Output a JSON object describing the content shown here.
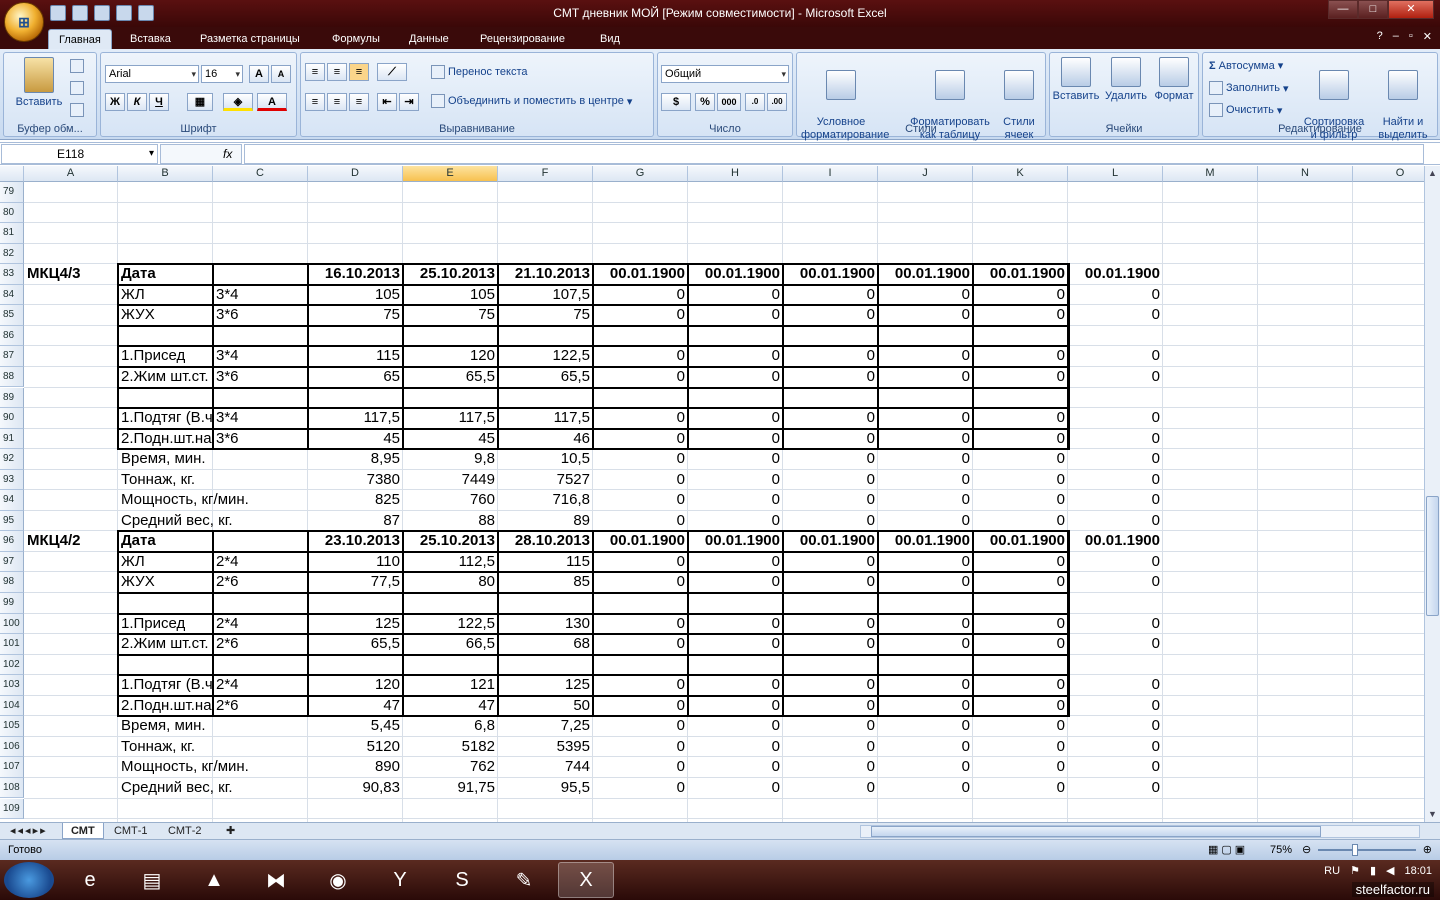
{
  "window": {
    "title": "СМТ дневник МОЙ  [Режим совместимости]  -  Microsoft Excel",
    "minimize": "—",
    "maximize": "□",
    "close": "✕"
  },
  "ribbon_tabs": [
    "Главная",
    "Вставка",
    "Разметка страницы",
    "Формулы",
    "Данные",
    "Рецензирование",
    "Вид"
  ],
  "ribbon": {
    "clipboard": {
      "paste": "Вставить",
      "name": "Буфер обм..."
    },
    "font": {
      "family": "Arial",
      "size": "16",
      "bold": "Ж",
      "italic": "К",
      "underline": "Ч",
      "grow": "A",
      "shrink": "A",
      "name": "Шрифт"
    },
    "alignment": {
      "wrap": "Перенос текста",
      "merge": "Объединить и поместить в центре",
      "name": "Выравнивание"
    },
    "number": {
      "format": "Общий",
      "percent": "%",
      "thousands": "000",
      "name": "Число"
    },
    "styles": {
      "conditional": "Условное\nформатирование",
      "as_table": "Форматировать\nкак таблицу",
      "cell_styles": "Стили\nячеек",
      "name": "Стили"
    },
    "cells": {
      "insert": "Вставить",
      "delete": "Удалить",
      "format": "Формат",
      "name": "Ячейки"
    },
    "editing": {
      "autosum": "Автосумма",
      "fill": "Заполнить",
      "clear": "Очистить",
      "sort": "Сортировка\nи фильтр",
      "find": "Найти и\nвыделить",
      "name": "Редактирование"
    }
  },
  "formula_bar": {
    "name_box": "E118",
    "fx": "fx",
    "content": ""
  },
  "columns": [
    "A",
    "B",
    "C",
    "D",
    "E",
    "F",
    "G",
    "H",
    "I",
    "J",
    "K",
    "L",
    "M",
    "N",
    "O"
  ],
  "selected_column": "E",
  "rows": [
    {
      "n": "79",
      "cells": []
    },
    {
      "n": "80",
      "cells": []
    },
    {
      "n": "81",
      "cells": []
    },
    {
      "n": "82",
      "cells": []
    },
    {
      "n": "83",
      "cells": [
        "МКЦ4/3",
        "Дата",
        "",
        "16.10.2013",
        "25.10.2013",
        "21.10.2013",
        "00.01.1900",
        "00.01.1900",
        "00.01.1900",
        "00.01.1900",
        "00.01.1900",
        "00.01.1900"
      ],
      "bold": true
    },
    {
      "n": "84",
      "cells": [
        "",
        "ЖЛ",
        "3*4",
        "105",
        "105",
        "107,5",
        "0",
        "0",
        "0",
        "0",
        "0",
        "0"
      ]
    },
    {
      "n": "85",
      "cells": [
        "",
        "ЖУХ",
        "3*6",
        "75",
        "75",
        "75",
        "0",
        "0",
        "0",
        "0",
        "0",
        "0"
      ]
    },
    {
      "n": "86",
      "cells": []
    },
    {
      "n": "87",
      "cells": [
        "",
        "1.Присед",
        "3*4",
        "115",
        "120",
        "122,5",
        "0",
        "0",
        "0",
        "0",
        "0",
        "0"
      ]
    },
    {
      "n": "88",
      "cells": [
        "",
        "2.Жим шт.ст.",
        "3*6",
        "65",
        "65,5",
        "65,5",
        "0",
        "0",
        "0",
        "0",
        "0",
        "0"
      ]
    },
    {
      "n": "89",
      "cells": []
    },
    {
      "n": "90",
      "cells": [
        "",
        "1.Подтяг (В.ч",
        "3*4",
        "117,5",
        "117,5",
        "117,5",
        "0",
        "0",
        "0",
        "0",
        "0",
        "0"
      ]
    },
    {
      "n": "91",
      "cells": [
        "",
        "2.Подн.шт.на",
        "3*6",
        "45",
        "45",
        "46",
        "0",
        "0",
        "0",
        "0",
        "0",
        "0"
      ]
    },
    {
      "n": "92",
      "cells": [
        "",
        "Время, мин.",
        "",
        "8,95",
        "9,8",
        "10,5",
        "0",
        "0",
        "0",
        "0",
        "0",
        "0"
      ]
    },
    {
      "n": "93",
      "cells": [
        "",
        "Тоннаж, кг.",
        "",
        "7380",
        "7449",
        "7527",
        "0",
        "0",
        "0",
        "0",
        "0",
        "0"
      ]
    },
    {
      "n": "94",
      "cells": [
        "",
        "Мощность, кг/мин.",
        "",
        "825",
        "760",
        "716,8",
        "0",
        "0",
        "0",
        "0",
        "0",
        "0"
      ]
    },
    {
      "n": "95",
      "cells": [
        "",
        "Средний вес, кг.",
        "",
        "87",
        "88",
        "89",
        "0",
        "0",
        "0",
        "0",
        "0",
        "0"
      ]
    },
    {
      "n": "96",
      "cells": [
        "МКЦ4/2",
        "Дата",
        "",
        "23.10.2013",
        "25.10.2013",
        "28.10.2013",
        "00.01.1900",
        "00.01.1900",
        "00.01.1900",
        "00.01.1900",
        "00.01.1900",
        "00.01.1900"
      ],
      "bold": true
    },
    {
      "n": "97",
      "cells": [
        "",
        "ЖЛ",
        "2*4",
        "110",
        "112,5",
        "115",
        "0",
        "0",
        "0",
        "0",
        "0",
        "0"
      ]
    },
    {
      "n": "98",
      "cells": [
        "",
        "ЖУХ",
        "2*6",
        "77,5",
        "80",
        "85",
        "0",
        "0",
        "0",
        "0",
        "0",
        "0"
      ]
    },
    {
      "n": "99",
      "cells": []
    },
    {
      "n": "100",
      "cells": [
        "",
        "1.Присед",
        "2*4",
        "125",
        "122,5",
        "130",
        "0",
        "0",
        "0",
        "0",
        "0",
        "0"
      ]
    },
    {
      "n": "101",
      "cells": [
        "",
        "2.Жим шт.ст.",
        "2*6",
        "65,5",
        "66,5",
        "68",
        "0",
        "0",
        "0",
        "0",
        "0",
        "0"
      ]
    },
    {
      "n": "102",
      "cells": []
    },
    {
      "n": "103",
      "cells": [
        "",
        "1.Подтяг (В.ч",
        "2*4",
        "120",
        "121",
        "125",
        "0",
        "0",
        "0",
        "0",
        "0",
        "0"
      ]
    },
    {
      "n": "104",
      "cells": [
        "",
        "2.Подн.шт.на",
        "2*6",
        "47",
        "47",
        "50",
        "0",
        "0",
        "0",
        "0",
        "0",
        "0"
      ]
    },
    {
      "n": "105",
      "cells": [
        "",
        "Время, мин.",
        "",
        "5,45",
        "6,8",
        "7,25",
        "0",
        "0",
        "0",
        "0",
        "0",
        "0"
      ]
    },
    {
      "n": "106",
      "cells": [
        "",
        "Тоннаж, кг.",
        "",
        "5120",
        "5182",
        "5395",
        "0",
        "0",
        "0",
        "0",
        "0",
        "0"
      ]
    },
    {
      "n": "107",
      "cells": [
        "",
        "Мощность, кг/мин.",
        "",
        "890",
        "762",
        "744",
        "0",
        "0",
        "0",
        "0",
        "0",
        "0"
      ]
    },
    {
      "n": "108",
      "cells": [
        "",
        "Средний вес, кг.",
        "",
        "90,83",
        "91,75",
        "95,5",
        "0",
        "0",
        "0",
        "0",
        "0",
        "0"
      ]
    },
    {
      "n": "109",
      "cells": []
    }
  ],
  "sheet_tabs": [
    "СМТ",
    "СМТ-1",
    "СМТ-2"
  ],
  "active_sheet": "СМТ",
  "status": {
    "ready": "Готово",
    "zoom": "75%"
  },
  "taskbar": {
    "lang": "RU",
    "time": "18:01",
    "watermark": "steelfactor.ru"
  }
}
